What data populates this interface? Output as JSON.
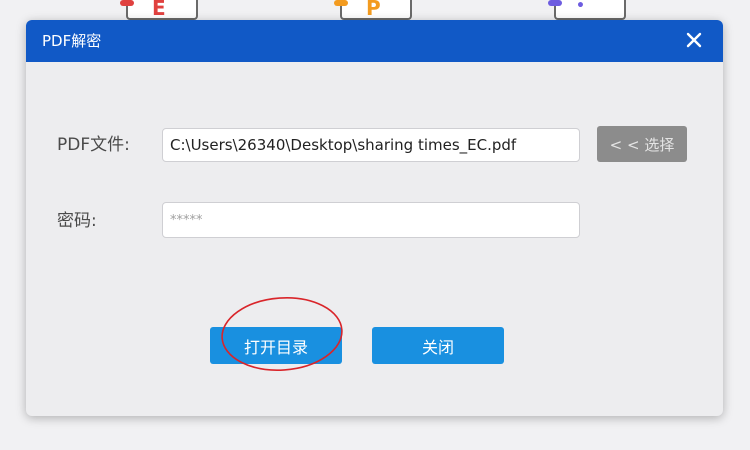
{
  "background": {
    "icons": [
      {
        "glyph": "E",
        "icon": "red-document-icon"
      },
      {
        "glyph": "P",
        "icon": "orange-document-icon"
      },
      {
        "glyph": "•",
        "icon": "purple-document-icon"
      }
    ]
  },
  "dialog": {
    "title": "PDF解密",
    "close_icon": "close-icon",
    "pdf_file_label": "PDF文件:",
    "pdf_file_value": "C:\\Users\\26340\\Desktop\\sharing times_EC.pdf",
    "select_button_label": "< < 选择",
    "password_label": "密码:",
    "password_placeholder": "*****",
    "open_dir_button_label": "打开目录",
    "close_button_label": "关闭"
  },
  "colors": {
    "title_bar": "#1159c6",
    "primary_button": "#1990e0",
    "disabled_button": "#8c8c8c",
    "annotation": "#d9252a"
  }
}
